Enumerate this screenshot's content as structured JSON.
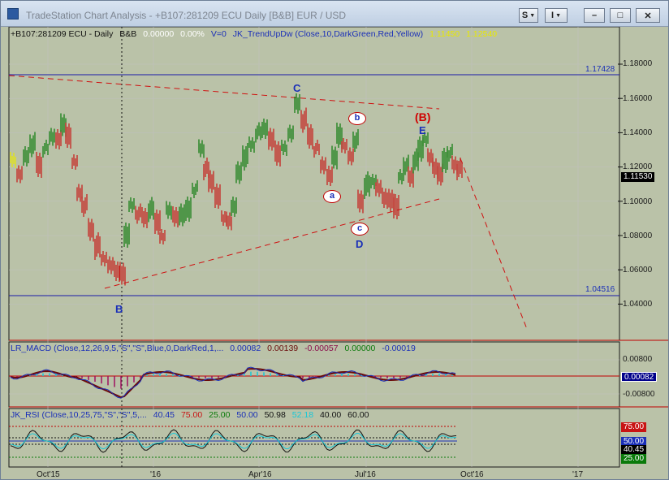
{
  "window": {
    "title": "TradeStation Chart Analysis - +B107:281209 ECU Daily [B&B] EUR / USD",
    "buttons": {
      "s": "S",
      "i": "I",
      "min": "–",
      "max": "□",
      "close": "✕"
    }
  },
  "price_panel": {
    "legend": {
      "symbol": "+B107:281209 ECU - Daily",
      "session": "B&B",
      "change": "0.00000",
      "pct": "0.00%",
      "volume": "V=0",
      "indicator": "JK_TrendUpDw (Close,10,DarkGreen,Red,Yellow)",
      "val1": "1.11450",
      "val2": "1.12540"
    },
    "axis_ticks": [
      "1.18000",
      "1.16000",
      "1.14000",
      "1.12000",
      "1.10000",
      "1.08000",
      "1.06000",
      "1.04000"
    ],
    "hline_top": "1.17428",
    "hline_bottom": "1.04516",
    "last_price": "1.11530",
    "wave_labels": {
      "B": "B",
      "C": "C",
      "D": "D",
      "E": "E",
      "big_B": "(B)",
      "a": "a",
      "b": "b",
      "c": "c"
    }
  },
  "macd_panel": {
    "legend": {
      "name": "LR_MACD (Close,12,26,9,5,\"S\",\"S\",Blue,0,DarkRed,1,...",
      "v1": "0.00082",
      "v2": "0.00139",
      "v3": "-0.00057",
      "v4": "0.00000",
      "v5": "-0.00019"
    },
    "axis_ticks": [
      "0.00800",
      "-0.00800"
    ],
    "tag": "0.00082"
  },
  "rsi_panel": {
    "legend": {
      "name": "JK_RSI (Close,10,25,75,\"S\",\"S\",5,...",
      "v1": "40.45",
      "v2": "75.00",
      "v3": "25.00",
      "v4": "50.00",
      "v5": "50.98",
      "v6": "52.18",
      "v7": "40.00",
      "v8": "60.00"
    },
    "tags": {
      "t75": "75.00",
      "t50": "50.00",
      "t40": "40.45",
      "t25": "25.00"
    }
  },
  "x_axis": [
    "Oct'15",
    "'16",
    "Apr'16",
    "Jul'16",
    "Oct'16",
    "'17"
  ],
  "colors": {
    "background": "#bac2a8",
    "up": "#0a7a0a",
    "down": "#c81414",
    "neutral": "#e8e800",
    "grid": "#c0c0c0",
    "trendline": "#d01010",
    "level": "#1a1aa8"
  }
}
